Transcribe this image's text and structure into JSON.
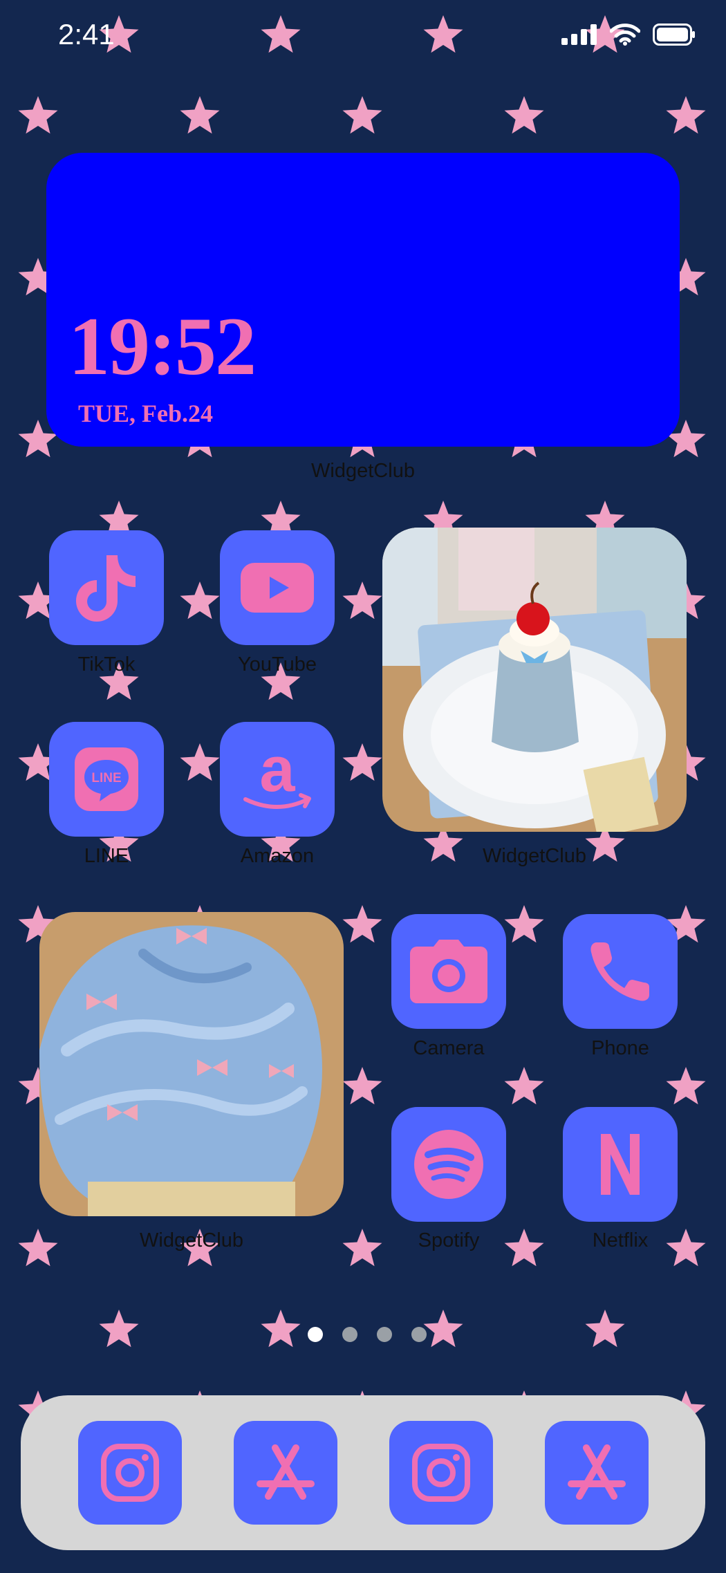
{
  "status_bar": {
    "time": "2:41"
  },
  "clock_widget": {
    "time": "19:52",
    "date": "TUE, Feb.24",
    "label": "WidgetClub"
  },
  "apps": [
    {
      "name": "TikTok",
      "icon": "tiktok-icon"
    },
    {
      "name": "YouTube",
      "icon": "youtube-icon"
    },
    {
      "name": "LINE",
      "icon": "line-icon"
    },
    {
      "name": "Amazon",
      "icon": "amazon-icon"
    },
    {
      "name": "Camera",
      "icon": "camera-icon"
    },
    {
      "name": "Phone",
      "icon": "phone-icon"
    },
    {
      "name": "Spotify",
      "icon": "spotify-icon"
    },
    {
      "name": "Netflix",
      "icon": "netflix-icon"
    }
  ],
  "photo_widgets": [
    {
      "label": "WidgetClub",
      "subject": "pudding-with-cherry"
    },
    {
      "label": "WidgetClub",
      "subject": "blue-ice-cream-with-bows"
    }
  ],
  "page_dots": {
    "count": 4,
    "active": 1
  },
  "dock": [
    {
      "icon": "instagram-icon"
    },
    {
      "icon": "app-store-icon"
    },
    {
      "icon": "instagram-icon"
    },
    {
      "icon": "app-store-icon"
    }
  ],
  "colors": {
    "background": "#13274f",
    "star": "#f0a1c4",
    "icon_bg": "#5065ff",
    "icon_fg": "#f06fb2",
    "clock_widget_bg": "#0000ff",
    "dock_bg": "#d6d6d6"
  }
}
